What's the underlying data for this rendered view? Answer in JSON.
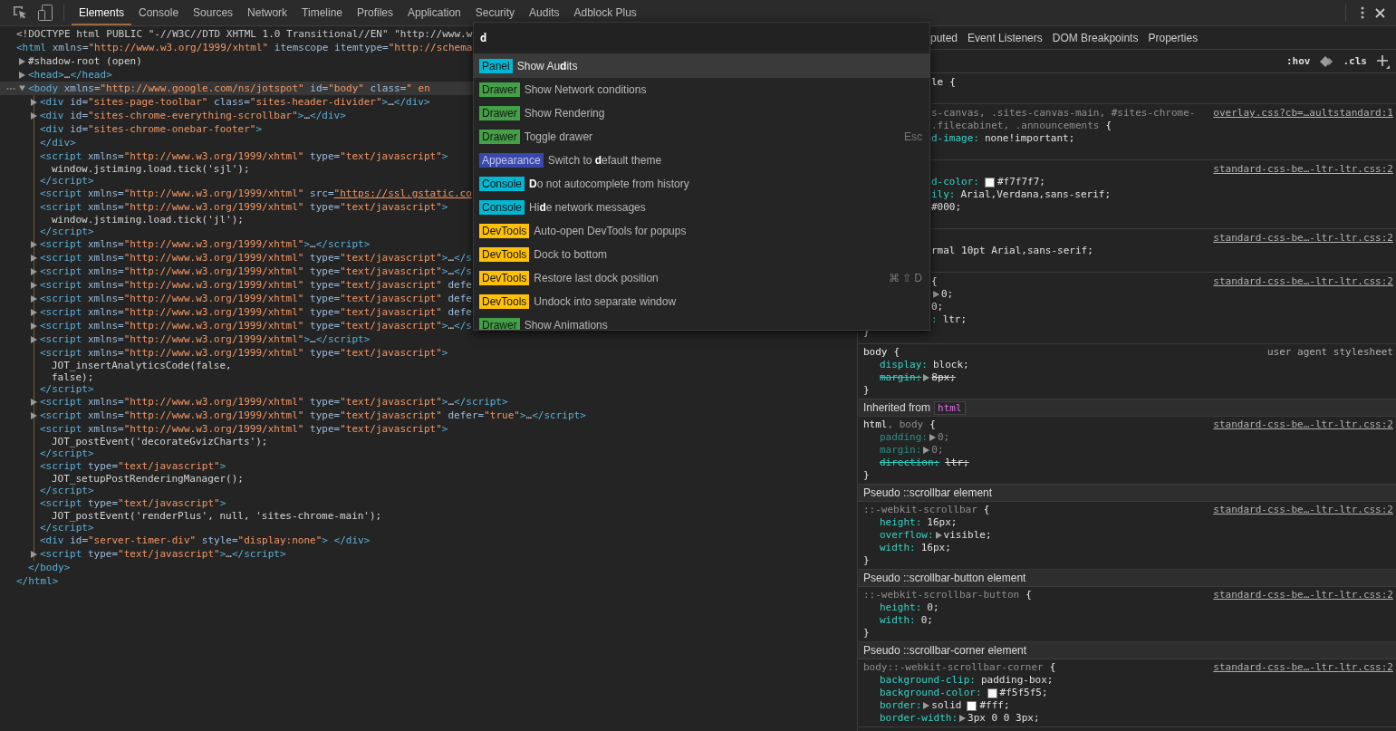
{
  "toolbar": {
    "tabs": [
      {
        "label": "Elements",
        "selected": true
      },
      {
        "label": "Console",
        "selected": false
      },
      {
        "label": "Sources",
        "selected": false
      },
      {
        "label": "Network",
        "selected": false
      },
      {
        "label": "Timeline",
        "selected": false
      },
      {
        "label": "Profiles",
        "selected": false
      },
      {
        "label": "Application",
        "selected": false
      },
      {
        "label": "Security",
        "selected": false
      },
      {
        "label": "Audits",
        "selected": false
      },
      {
        "label": "Adblock Plus",
        "selected": false
      }
    ]
  },
  "dom_tree": [
    {
      "kind": "doctype",
      "line": "<!DOCTYPE html PUBLIC \"-//W3C//DTD XHTML 1.0 Transitional//EN\" \"http://www.w",
      "selected": false
    },
    {
      "kind": "tag",
      "line": "<html xmlns=\"http://www.w3.org/1999/xhtml\" itemscope itemtype=\"http://schema",
      "selected": false,
      "close": "</html>",
      "children": [
        {
          "kind": "shadow",
          "line": "#shadow-root (open)",
          "expanded": false,
          "selected": false
        },
        {
          "kind": "tag",
          "line": "<head>…</head>",
          "expanded": false,
          "selected": false
        },
        {
          "kind": "tag",
          "line": "<body xmlns=\"http://www.google.com/ns/jotspot\" id=\"body\" class=\" en",
          "expanded": true,
          "selected": true,
          "close": "</body>",
          "children": [
            {
              "kind": "tag",
              "line": "<div id=\"sites-page-toolbar\" class=\"sites-header-divider\">…</div>",
              "expanded": false,
              "selected": false
            },
            {
              "kind": "tag",
              "line": "<div id=\"sites-chrome-everything-scrollbar\">…</div>",
              "expanded": false,
              "selected": false
            },
            {
              "kind": "tag",
              "line": "<div id=\"sites-chrome-onebar-footer\">",
              "selected": false,
              "close": "</div>"
            },
            {
              "kind": "tag",
              "line": "<script xmlns=\"http://www.w3.org/1999/xhtml\" type=\"text/javascript\">",
              "selected": false,
              "close": "</script>",
              "children": [
                {
                  "kind": "text",
                  "line": "window.jstiming.load.tick('sjl');",
                  "selected": false
                }
              ]
            },
            {
              "kind": "tag",
              "line": "<script xmlns=\"http://www.w3.org/1999/xhtml\" src=\"https://ssl.gstatic.co",
              "linked": true,
              "selected": false
            },
            {
              "kind": "tag",
              "line": "<script xmlns=\"http://www.w3.org/1999/xhtml\" type=\"text/javascript\">",
              "selected": false,
              "close": "</script>",
              "children": [
                {
                  "kind": "text",
                  "line": "window.jstiming.load.tick('jl');",
                  "selected": false
                }
              ]
            },
            {
              "kind": "tag",
              "line": "<script xmlns=\"http://www.w3.org/1999/xhtml\">…</script>",
              "expanded": false,
              "selected": false
            },
            {
              "kind": "tag",
              "line": "<script xmlns=\"http://www.w3.org/1999/xhtml\" type=\"text/javascript\">…</s",
              "expanded": false,
              "selected": false
            },
            {
              "kind": "tag",
              "line": "<script xmlns=\"http://www.w3.org/1999/xhtml\" type=\"text/javascript\">…</s",
              "expanded": false,
              "selected": false
            },
            {
              "kind": "tag",
              "line": "<script xmlns=\"http://www.w3.org/1999/xhtml\" type=\"text/javascript\" defe",
              "expanded": false,
              "selected": false
            },
            {
              "kind": "tag",
              "line": "<script xmlns=\"http://www.w3.org/1999/xhtml\" type=\"text/javascript\" defe",
              "expanded": false,
              "selected": false
            },
            {
              "kind": "tag",
              "line": "<script xmlns=\"http://www.w3.org/1999/xhtml\" type=\"text/javascript\" defe",
              "expanded": false,
              "selected": false
            },
            {
              "kind": "tag",
              "line": "<script xmlns=\"http://www.w3.org/1999/xhtml\" type=\"text/javascript\">…</s",
              "expanded": false,
              "selected": false
            },
            {
              "kind": "tag",
              "line": "<script xmlns=\"http://www.w3.org/1999/xhtml\">…</script>",
              "expanded": false,
              "selected": false
            },
            {
              "kind": "tag",
              "line": "<script xmlns=\"http://www.w3.org/1999/xhtml\" type=\"text/javascript\">",
              "selected": false,
              "close": "</script>",
              "children": [
                {
                  "kind": "text",
                  "line": "JOT_insertAnalyticsCode(false,",
                  "selected": false
                },
                {
                  "kind": "text",
                  "line": "false);",
                  "selected": false
                }
              ]
            },
            {
              "kind": "tag",
              "line": "<script xmlns=\"http://www.w3.org/1999/xhtml\" type=\"text/javascript\">…</script>",
              "expanded": false,
              "selected": false
            },
            {
              "kind": "tag",
              "line": "<script xmlns=\"http://www.w3.org/1999/xhtml\" type=\"text/javascript\" defer=\"true\">…</script>",
              "expanded": false,
              "selected": false
            },
            {
              "kind": "tag",
              "line": "<script xmlns=\"http://www.w3.org/1999/xhtml\" type=\"text/javascript\">",
              "selected": false,
              "close": "</script>",
              "children": [
                {
                  "kind": "text",
                  "line": "JOT_postEvent('decorateGvizCharts');",
                  "selected": false
                }
              ]
            },
            {
              "kind": "tag",
              "line": "<script type=\"text/javascript\">",
              "selected": false,
              "close": "</script>",
              "children": [
                {
                  "kind": "text",
                  "line": "JOT_setupPostRenderingManager();",
                  "selected": false
                }
              ]
            },
            {
              "kind": "tag",
              "line": "<script type=\"text/javascript\">",
              "selected": false,
              "close": "</script>",
              "children": [
                {
                  "kind": "text",
                  "line": "JOT_postEvent('renderPlus', null, 'sites-chrome-main');",
                  "selected": false
                }
              ]
            },
            {
              "kind": "tag",
              "line": "<div id=\"server-timer-div\" style=\"display:none\"> </div>",
              "selected": false
            },
            {
              "kind": "tag",
              "line": "<script type=\"text/javascript\">…</script>",
              "expanded": false,
              "selected": false
            }
          ]
        }
      ]
    }
  ],
  "command_menu": {
    "query": "d",
    "items": [
      {
        "category": "Panel",
        "color": "#00b8d4",
        "label": "Show Au**d**its",
        "selected": true
      },
      {
        "category": "Drawer",
        "color": "#43a047",
        "label": "Show Network conditions",
        "selected": false
      },
      {
        "category": "Drawer",
        "color": "#43a047",
        "label": "Show Rendering",
        "selected": false
      },
      {
        "category": "Drawer",
        "color": "#43a047",
        "label": "Toggle drawer",
        "shortcut": "Esc",
        "selected": false
      },
      {
        "category": "Appearance",
        "color": "#3949ab",
        "label": "Switch to **d**efault theme",
        "selected": false
      },
      {
        "category": "Console",
        "color": "#00b8d4",
        "label": "**D**o not autocomplete from history",
        "selected": false
      },
      {
        "category": "Console",
        "color": "#00b8d4",
        "label": "Hi**d**e network messages",
        "selected": false
      },
      {
        "category": "DevTools",
        "color": "#ffc107",
        "label": "Auto-open DevTools for popups",
        "selected": false
      },
      {
        "category": "DevTools",
        "color": "#ffc107",
        "label": "Dock to bottom",
        "selected": false
      },
      {
        "category": "DevTools",
        "color": "#ffc107",
        "label": "Restore last dock position",
        "shortcut": "⌘ ⇧ D",
        "selected": false
      },
      {
        "category": "DevTools",
        "color": "#ffc107",
        "label": "Undock into separate window",
        "selected": false
      },
      {
        "category": "Drawer",
        "color": "#43a047",
        "label": "Show Animations",
        "selected": false
      }
    ]
  },
  "sidebar": {
    "tabs": [
      {
        "label": "puted",
        "selected": false
      },
      {
        "label": "Event Listeners",
        "selected": false
      },
      {
        "label": "DOM Breakpoints",
        "selected": false
      },
      {
        "label": "Properties",
        "selected": false
      }
    ],
    "hov": ":hov",
    "cls": ".cls",
    "sections": [
      {
        "kind": "rule",
        "clipped": true,
        "selector_lines": [
          [
            {
              "text": "le",
              "matched": true
            }
          ]
        ],
        "open": "{"
      },
      {
        "kind": "rule",
        "clipped": true,
        "source": "overlay.css?cb=…aultstandard:1",
        "source_link": true,
        "selector_lines": [
          [
            {
              "text": "s-canvas, .sites-canvas-main, #sites-chrome-",
              "matched": false
            }
          ],
          [
            {
              "text": ".filecabinet, .announcements",
              "matched": false
            }
          ]
        ],
        "open": "{",
        "decls": [
          {
            "prop": "d-image:",
            "value": "none!important;"
          }
        ]
      },
      {
        "kind": "rule",
        "clipped": true,
        "source": "standard-css-be…-ltr-ltr.css:2",
        "source_link": true,
        "decls": [
          {
            "prop": "d-color:",
            "color": "#f7f7f7",
            "value": "#f7f7f7;"
          },
          {
            "prop": "ily:",
            "value": "Arial,Verdana,sans-serif;"
          },
          {
            "value": "#000;"
          }
        ]
      },
      {
        "kind": "rule",
        "clipped": true,
        "source": "standard-css-be…-ltr-ltr.css:2",
        "source_link": true,
        "decls": [
          {
            "value": "rmal 10pt Arial,sans-serif;"
          }
        ]
      },
      {
        "kind": "rule",
        "clipped": true,
        "source": "standard-css-be…-ltr-ltr.css:2",
        "source_link": true,
        "open": "{",
        "decls": [
          {
            "expand": true,
            "value": "0;"
          },
          {
            "value": "0;"
          },
          {
            "prop": ":",
            "value": "ltr;"
          }
        ],
        "close": "}"
      },
      {
        "kind": "rule",
        "source": "user agent stylesheet",
        "source_link": false,
        "selector_lines": [
          [
            {
              "text": "body",
              "matched": true
            }
          ]
        ],
        "open": "{",
        "decls": [
          {
            "prop": "display:",
            "value": "block;"
          },
          {
            "prop": "margin:",
            "expand": true,
            "value": "8px;",
            "struck": true
          }
        ],
        "close": "}"
      },
      {
        "kind": "header",
        "label": "Inherited from",
        "tag": "html"
      },
      {
        "kind": "rule",
        "source": "standard-css-be…-ltr-ltr.css:2",
        "source_link": true,
        "selector_lines": [
          [
            {
              "text": "html",
              "matched": true
            },
            {
              "text": ", body",
              "matched": false
            }
          ]
        ],
        "open": "{",
        "decls": [
          {
            "prop": "padding:",
            "expand": true,
            "value": "0;",
            "inactive": true
          },
          {
            "prop": "margin:",
            "expand": true,
            "value": "0;",
            "inactive": true
          },
          {
            "prop": "direction:",
            "value": "ltr;",
            "struck": true
          }
        ],
        "close": "}"
      },
      {
        "kind": "header",
        "label": "Pseudo ::scrollbar element"
      },
      {
        "kind": "rule",
        "source": "standard-css-be…-ltr-ltr.css:2",
        "source_link": true,
        "selector_lines": [
          [
            {
              "text": "::-webkit-scrollbar",
              "matched": false
            }
          ]
        ],
        "open": "{",
        "decls": [
          {
            "prop": "height:",
            "value": "16px;"
          },
          {
            "prop": "overflow:",
            "expand": true,
            "value": "visible;"
          },
          {
            "prop": "width:",
            "value": "16px;"
          }
        ],
        "close": "}"
      },
      {
        "kind": "header",
        "label": "Pseudo ::scrollbar-button element"
      },
      {
        "kind": "rule",
        "source": "standard-css-be…-ltr-ltr.css:2",
        "source_link": true,
        "selector_lines": [
          [
            {
              "text": "::-webkit-scrollbar-button",
              "matched": false
            }
          ]
        ],
        "open": "{",
        "decls": [
          {
            "prop": "height:",
            "value": "0;"
          },
          {
            "prop": "width:",
            "value": "0;"
          }
        ],
        "close": "}"
      },
      {
        "kind": "header",
        "label": "Pseudo ::scrollbar-corner element"
      },
      {
        "kind": "rule",
        "source": "standard-css-be…-ltr-ltr.css:2",
        "source_link": true,
        "selector_lines": [
          [
            {
              "text": "body::-webkit-scrollbar-corner",
              "matched": false
            }
          ]
        ],
        "open": "{",
        "decls": [
          {
            "prop": "background-clip:",
            "value": "padding-box;"
          },
          {
            "prop": "background-color:",
            "color": "#f5f5f5",
            "value": "#f5f5f5;"
          },
          {
            "prop": "border:",
            "expand": true,
            "pre": "solid",
            "color": "#ffffff",
            "value": "#fff;"
          },
          {
            "prop": "border-width:",
            "expand": true,
            "value": "3px 0 0 3px;"
          }
        ]
      }
    ]
  }
}
